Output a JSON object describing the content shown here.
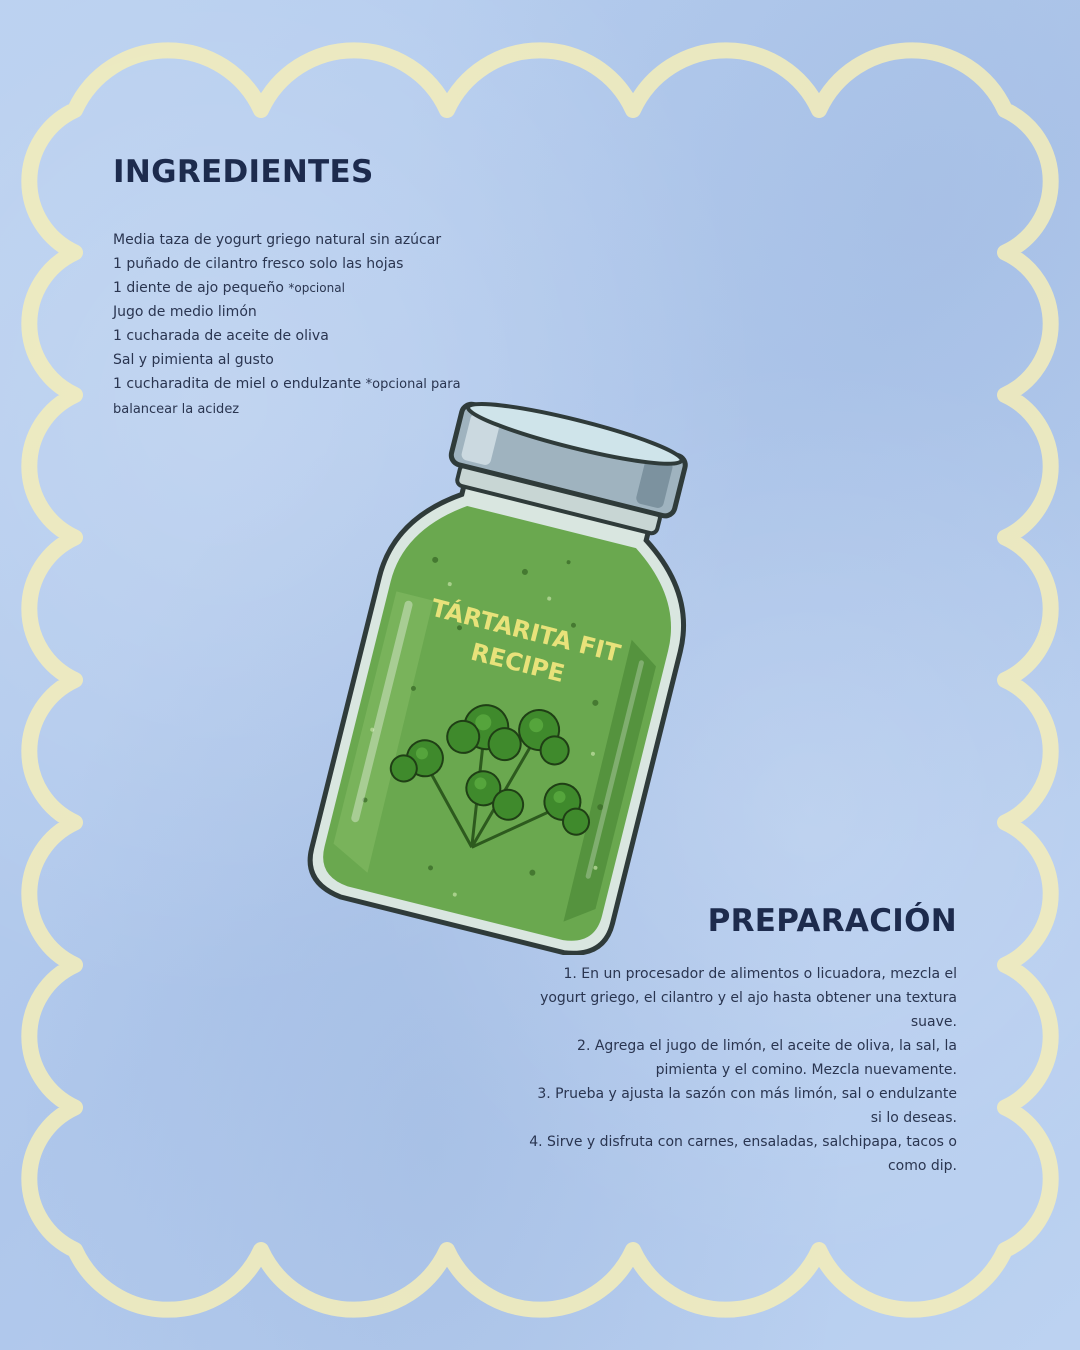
{
  "ingredients": {
    "title": "INGREDIENTES",
    "items": [
      {
        "text": "Media taza de yogurt griego natural sin azúcar",
        "note": ""
      },
      {
        "text": "1 puñado de cilantro fresco solo las hojas",
        "note": ""
      },
      {
        "text": "1 diente de ajo pequeño ",
        "note": "*opcional"
      },
      {
        "text": "Jugo de medio limón",
        "note": ""
      },
      {
        "text": "1 cucharada de aceite de oliva",
        "note": ""
      },
      {
        "text": "Sal y pimienta al gusto",
        "note": ""
      },
      {
        "text": "1 cucharadita de miel o endulzante ",
        "note": "*opcional para balancear la acidez"
      }
    ]
  },
  "preparation": {
    "title": "PREPARACIÓN",
    "steps": [
      "1.  En un procesador de alimentos o licuadora, mezcla el yogurt griego, el cilantro y el ajo hasta obtener una textura suave.",
      "2. Agrega el jugo de limón, el aceite de oliva, la sal, la pimienta y el comino. Mezcla nuevamente.",
      "3. Prueba y ajusta la sazón con más limón, sal o endulzante si lo deseas.",
      "4. Sirve y disfruta con carnes, ensaladas, salchipapa, tacos o como dip."
    ]
  },
  "jar": {
    "label_line1": "TÁRTARITA FIT",
    "label_line2": "RECIPE"
  },
  "colors": {
    "background": "#b6cdee",
    "frame": "#f4edb8",
    "heading": "#1d2b4d",
    "sauce": "#6aa84f",
    "label": "#e8e27a"
  }
}
